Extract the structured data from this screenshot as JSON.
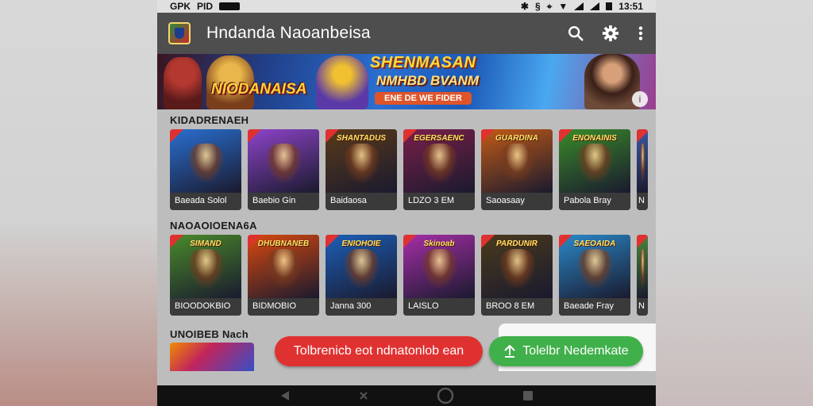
{
  "status_bar": {
    "left_text": "GPK",
    "left_extra": "PID",
    "time": "13:51"
  },
  "app_bar": {
    "title": "Hndanda Naoanbeisa",
    "icons": [
      "search-icon",
      "settings-icon",
      "more-vert-icon"
    ]
  },
  "banner": {
    "left_text": "NIODANAISA",
    "title": "SHENMASAN",
    "subtitle": "NMHBD BVANM",
    "pill": "ENE DE WE FIDER"
  },
  "sections": [
    {
      "label": "KIDADRENAEH",
      "cards": [
        {
          "art": "",
          "label": "Baeada Solol",
          "bg": "#2a6fd1"
        },
        {
          "art": "",
          "label": "Baebio Gin",
          "bg": "#8e44c9"
        },
        {
          "art": "SHANTADUS",
          "label": "Baidaosa",
          "bg": "#5a3a1a"
        },
        {
          "art": "EGERSAENC",
          "label": "LDZO 3 EM",
          "bg": "#7a1f4a"
        },
        {
          "art": "GUARDINA",
          "label": "Saoasaay",
          "bg": "#c25a16"
        },
        {
          "art": "ENONAINIS",
          "label": "Pabola Bray",
          "bg": "#3a8a2a"
        },
        {
          "art": "",
          "label": "N",
          "bg": "#3a5aa8"
        }
      ]
    },
    {
      "label": "NAOAOIOENA6A",
      "cards": [
        {
          "art": "SIMAND",
          "label": "BIOODOKBIO",
          "bg": "#4a8a2a"
        },
        {
          "art": "DHUBNANEB",
          "label": "BIDMOBIO",
          "bg": "#d9480f"
        },
        {
          "art": "ENIOHOIE",
          "label": "Janna 300",
          "bg": "#1c5fb8"
        },
        {
          "art": "Skinoab",
          "label": "LAISLO",
          "bg": "#a62ea8"
        },
        {
          "art": "PARDUNIR",
          "label": "BROO 8 EM",
          "bg": "#4a3a1c"
        },
        {
          "art": "SAEOAIDA",
          "label": "Baeade Fray",
          "bg": "#2a88c8"
        },
        {
          "art": "",
          "label": "N",
          "bg": "#4a8a3a"
        }
      ]
    }
  ],
  "bottom": {
    "section_label": "UNOIBEB Nach",
    "red_button": "Tolbrenicb eot ndnatonlob ean",
    "green_button": "Tolelbr Nedemkate"
  }
}
